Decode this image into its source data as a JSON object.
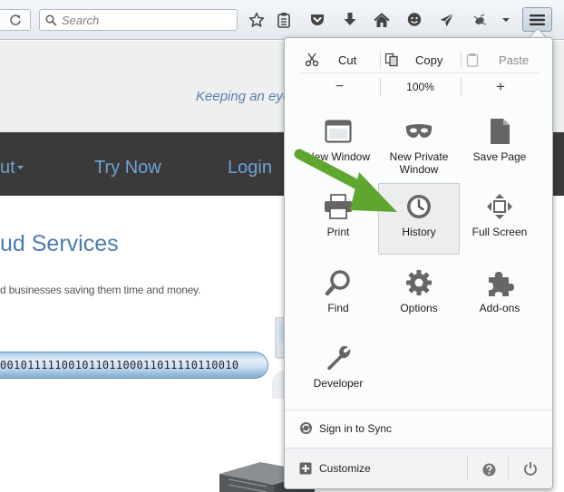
{
  "toolbar": {
    "search_placeholder": "Search"
  },
  "page": {
    "tagline": "Keeping an eye",
    "nav": [
      "ut",
      "Try Now",
      "Login"
    ],
    "heading": "ud Services",
    "subtext": "d businesses saving them time and money.",
    "binary": "00101111100101101100011011110110010"
  },
  "menu": {
    "edit": {
      "cut": "Cut",
      "copy": "Copy",
      "paste": "Paste"
    },
    "zoom": {
      "out": "−",
      "level": "100%",
      "in": "+"
    },
    "items": [
      {
        "label": "New Window",
        "icon": "new-window-icon"
      },
      {
        "label": "New Private Window",
        "icon": "private-mask-icon"
      },
      {
        "label": "Save Page",
        "icon": "save-page-icon"
      },
      {
        "label": "Print",
        "icon": "printer-icon"
      },
      {
        "label": "History",
        "icon": "history-clock-icon"
      },
      {
        "label": "Full Screen",
        "icon": "fullscreen-icon"
      },
      {
        "label": "Find",
        "icon": "magnifier-icon"
      },
      {
        "label": "Options",
        "icon": "gear-icon"
      },
      {
        "label": "Add-ons",
        "icon": "puzzle-icon"
      },
      {
        "label": "Developer",
        "icon": "wrench-icon"
      }
    ],
    "sync_label": "Sign in to Sync",
    "customize_label": "Customize"
  },
  "colors": {
    "accent_arrow": "#5fa630",
    "nav_bar": "#3b3939",
    "link_blue": "#6aa3d6"
  }
}
